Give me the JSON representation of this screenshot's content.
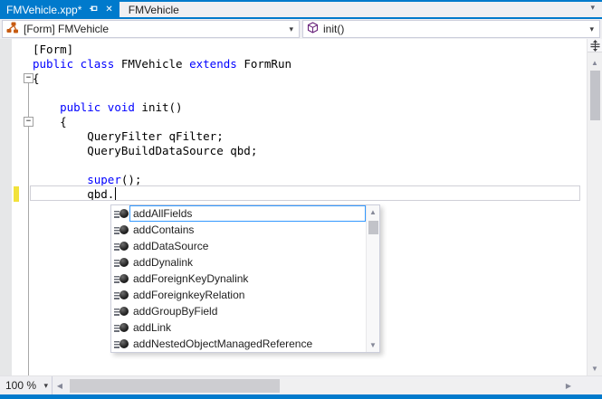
{
  "window": {
    "accent_color": "#007ACC",
    "background_color": "#EFEFF2"
  },
  "icons": {
    "dropdown_arrow": "▾",
    "tab_overflow_arrow": "▾",
    "close_glyph": "✕",
    "scroll_up_glyph": "▲",
    "scroll_down_glyph": "▼",
    "scroll_left_glyph": "◀",
    "scroll_right_glyph": "▶"
  },
  "tab_bar": {
    "active_tab": "FMVehicle.xpp*",
    "inactive_tab": "FMVehicle"
  },
  "navigation_bar": {
    "type_dropdown": "[Form] FMVehicle",
    "member_dropdown": "init()"
  },
  "editor": {
    "keyword_color": "#0000FF",
    "text_color": "#000000",
    "modified_line_marker_color": "#F2E23B",
    "lines": [
      {
        "tokens": [
          {
            "t": "[Form]",
            "c": "plain"
          }
        ]
      },
      {
        "tokens": [
          {
            "t": "public class ",
            "c": "kw"
          },
          {
            "t": "FMVehicle ",
            "c": "plain"
          },
          {
            "t": "extends ",
            "c": "kw"
          },
          {
            "t": "FormRun",
            "c": "plain"
          }
        ]
      },
      {
        "tokens": [
          {
            "t": "{",
            "c": "plain"
          }
        ]
      },
      {
        "tokens": []
      },
      {
        "tokens": [
          {
            "t": "    ",
            "c": "plain"
          },
          {
            "t": "public void ",
            "c": "kw"
          },
          {
            "t": "init()",
            "c": "plain"
          }
        ]
      },
      {
        "tokens": [
          {
            "t": "    {",
            "c": "plain"
          }
        ]
      },
      {
        "tokens": [
          {
            "t": "        QueryFilter qFilter;",
            "c": "plain"
          }
        ]
      },
      {
        "tokens": [
          {
            "t": "        QueryBuildDataSource qbd;",
            "c": "plain"
          }
        ]
      },
      {
        "tokens": []
      },
      {
        "tokens": [
          {
            "t": "        ",
            "c": "plain"
          },
          {
            "t": "super",
            "c": "kw"
          },
          {
            "t": "();",
            "c": "plain"
          }
        ]
      },
      {
        "tokens": [
          {
            "t": "        qbd.",
            "c": "plain"
          }
        ]
      }
    ]
  },
  "completion_popup": {
    "selected_border_color": "#3399FF",
    "items": [
      {
        "label": "addAllFields",
        "selected": true
      },
      {
        "label": "addContains",
        "selected": false
      },
      {
        "label": "addDataSource",
        "selected": false
      },
      {
        "label": "addDynalink",
        "selected": false
      },
      {
        "label": "addForeignKeyDynalink",
        "selected": false
      },
      {
        "label": "addForeignkeyRelation",
        "selected": false
      },
      {
        "label": "addGroupByField",
        "selected": false
      },
      {
        "label": "addLink",
        "selected": false
      },
      {
        "label": "addNestedObjectManagedReference",
        "selected": false
      }
    ]
  },
  "status_bar": {
    "zoom_level": "100 %"
  }
}
